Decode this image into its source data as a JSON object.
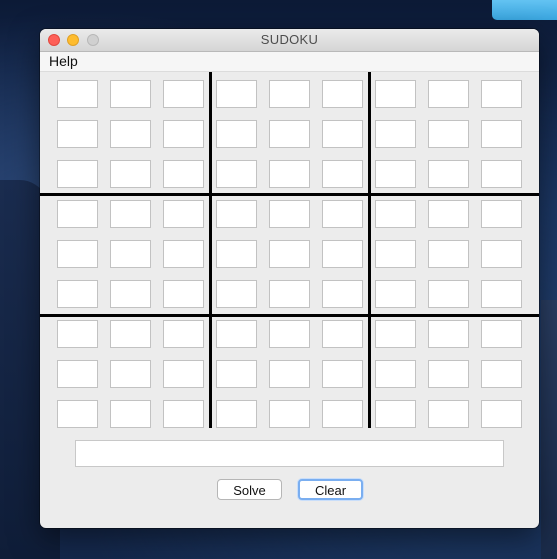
{
  "window": {
    "title": "SUDOKU"
  },
  "menu": {
    "items": [
      {
        "label": "Help"
      }
    ]
  },
  "board": {
    "rows": [
      [
        "",
        "",
        "",
        "",
        "",
        "",
        "",
        "",
        ""
      ],
      [
        "",
        "",
        "",
        "",
        "",
        "",
        "",
        "",
        ""
      ],
      [
        "",
        "",
        "",
        "",
        "",
        "",
        "",
        "",
        ""
      ],
      [
        "",
        "",
        "",
        "",
        "",
        "",
        "",
        "",
        ""
      ],
      [
        "",
        "",
        "",
        "",
        "",
        "",
        "",
        "",
        ""
      ],
      [
        "",
        "",
        "",
        "",
        "",
        "",
        "",
        "",
        ""
      ],
      [
        "",
        "",
        "",
        "",
        "",
        "",
        "",
        "",
        ""
      ],
      [
        "",
        "",
        "",
        "",
        "",
        "",
        "",
        "",
        ""
      ],
      [
        "",
        "",
        "",
        "",
        "",
        "",
        "",
        "",
        ""
      ]
    ]
  },
  "status": {
    "value": ""
  },
  "buttons": {
    "solve_label": "Solve",
    "clear_label": "Clear"
  },
  "colors": {
    "close": "#fe5f57",
    "minimize": "#febc2e",
    "zoom_disabled": "#d0d0d0",
    "focus_ring": "#7aaef0",
    "separator": "#000000"
  },
  "icons": {
    "close": "close-icon",
    "minimize": "minimize-icon",
    "zoom": "zoom-icon"
  }
}
